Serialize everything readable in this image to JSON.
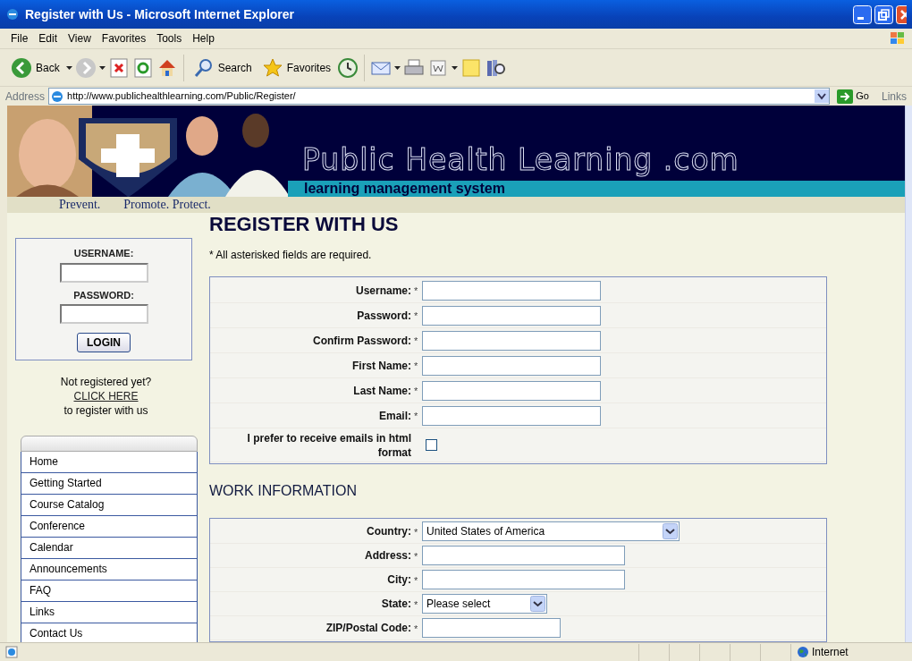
{
  "window": {
    "title": "Register with Us - Microsoft Internet Explorer"
  },
  "menu": [
    "File",
    "Edit",
    "View",
    "Favorites",
    "Tools",
    "Help"
  ],
  "toolbar": [
    {
      "kind": "back",
      "label": "Back"
    },
    {
      "kind": "forward"
    },
    {
      "kind": "stop"
    },
    {
      "kind": "refresh"
    },
    {
      "kind": "home"
    },
    {
      "kind": "search",
      "label": "Search"
    },
    {
      "kind": "favorites",
      "label": "Favorites"
    },
    {
      "kind": "history"
    },
    {
      "kind": "mail"
    },
    {
      "kind": "print"
    },
    {
      "kind": "edit"
    },
    {
      "kind": "note"
    },
    {
      "kind": "research"
    }
  ],
  "address": {
    "label": "Address",
    "url": "http://www.publichealthlearning.com/Public/Register/",
    "go": "Go",
    "links": "Links"
  },
  "banner": {
    "title": "Public Health Learning .com",
    "subtitle": "learning management system",
    "tagline": [
      "Prevent.",
      "Promote. Protect."
    ]
  },
  "login": {
    "username_label": "USERNAME:",
    "password_label": "PASSWORD:",
    "button": "LOGIN"
  },
  "register_prompt": {
    "line1": "Not registered yet?",
    "link": "CLICK HERE",
    "line2": "to register with us"
  },
  "nav": [
    "Home",
    "Getting Started",
    "Course Catalog",
    "Conference",
    "Calendar",
    "Announcements",
    "FAQ",
    "Links",
    "Contact Us"
  ],
  "heading": "REGISTER WITH US",
  "note": "* All asterisked fields are required.",
  "account_fields": [
    {
      "kind": "text",
      "label": "Username:",
      "mark": "*"
    },
    {
      "kind": "text",
      "label": "Password:",
      "mark": "*"
    },
    {
      "kind": "text",
      "label": "Confirm Password:",
      "mark": "*"
    },
    {
      "kind": "text",
      "label": "First Name:",
      "mark": "*"
    },
    {
      "kind": "text",
      "label": "Last Name:",
      "mark": "*"
    },
    {
      "kind": "text",
      "label": "Email:",
      "mark": "*"
    },
    {
      "kind": "checkbox",
      "label": "I prefer to receive emails in html format",
      "checked": false
    }
  ],
  "work_heading": "WORK INFORMATION",
  "work_fields": [
    {
      "kind": "select",
      "label": "Country:",
      "mark": "*",
      "value": "United States of America"
    },
    {
      "kind": "text",
      "label": "Address:",
      "mark": "*"
    },
    {
      "kind": "text",
      "label": "City:",
      "mark": "*"
    },
    {
      "kind": "select",
      "label": "State:",
      "mark": "*",
      "value": "Please select"
    },
    {
      "kind": "text",
      "label": "ZIP/Postal Code:",
      "mark": "*"
    }
  ],
  "status_bar": {
    "zone": "Internet"
  }
}
